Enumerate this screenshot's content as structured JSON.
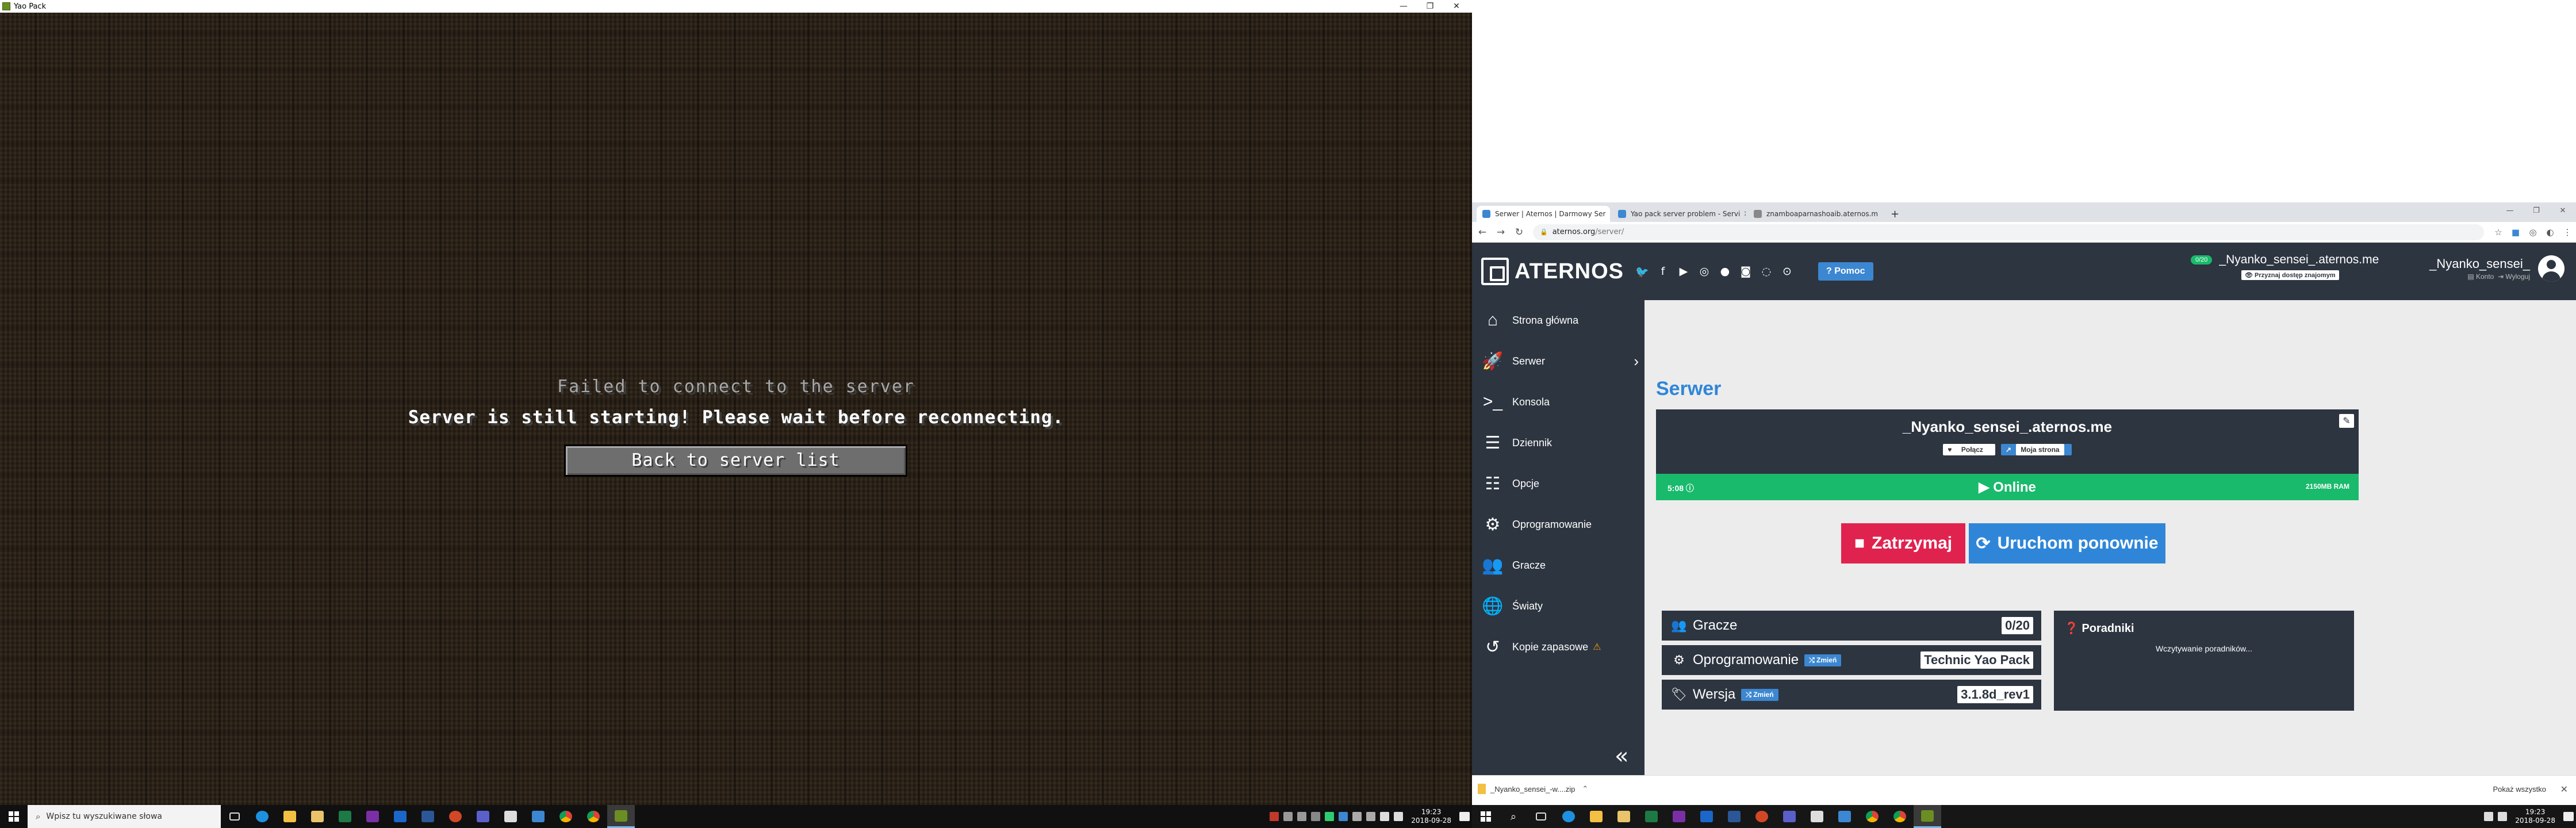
{
  "minecraft": {
    "window_title": "Yao Pack",
    "window_controls": {
      "minimize": "—",
      "maximize": "❐",
      "close": "✕"
    },
    "title": "Failed to connect to the server",
    "reason": "Server is still starting! Please wait before reconnecting.",
    "back_button": "Back to server list"
  },
  "taskbar_left": {
    "search_placeholder": "Wpisz tu wyszukiwane słowa",
    "clock_time": "19:23",
    "clock_date": "2018-09-28"
  },
  "taskbar_right": {
    "clock_time": "19:23",
    "clock_date": "2018-09-28"
  },
  "chrome": {
    "tabs": [
      {
        "label": "Serwer | Aternos | Darmowy Ser",
        "favicon_color": "#3c87d1"
      },
      {
        "label": "Yao pack server problem - Servi",
        "favicon_color": "#3c87d1"
      },
      {
        "label": "znamboaparnashoaib.aternos.m",
        "favicon_color": "#888888"
      }
    ],
    "new_tab": "+",
    "url_host": "aternos.org",
    "url_path": "/server/"
  },
  "aternos": {
    "logo": "ATERNOS",
    "help_button": "Pomoc",
    "status_pill": "0/20",
    "server_address": "_Nyanko_sensei_.aternos.me",
    "invite_button": "Przyznaj dostęp znajomym",
    "username": "_Nyanko_sensei_",
    "user_account": "Konto",
    "user_logout": "Wyloguj",
    "sidebar": [
      {
        "label": "Strona główna",
        "icon": "home-icon"
      },
      {
        "label": "Serwer",
        "icon": "rocket-icon"
      },
      {
        "label": "Konsola",
        "icon": "terminal-icon"
      },
      {
        "label": "Dziennik",
        "icon": "log-icon"
      },
      {
        "label": "Opcje",
        "icon": "sliders-icon"
      },
      {
        "label": "Oprogramowanie",
        "icon": "cogs-icon"
      },
      {
        "label": "Gracze",
        "icon": "users-icon"
      },
      {
        "label": "Światy",
        "icon": "globe-icon"
      },
      {
        "label": "Kopie zapasowe",
        "icon": "backup-icon"
      }
    ],
    "page_title": "Serwer",
    "card_address": "_Nyanko_sensei_.aternos.me",
    "connect_button": "Połącz",
    "my_page_button": "Moja strona",
    "status_left": "5:08",
    "status_center": "Online",
    "status_ram": "2150MB RAM",
    "stop_button": "Zatrzymaj",
    "restart_button": "Uruchom ponownie",
    "players_label": "Gracze",
    "players_value": "0/20",
    "software_label": "Oprogramowanie",
    "software_change": "Zmień",
    "software_value": "Technic Yao Pack",
    "version_label": "Wersja",
    "version_change": "Zmień",
    "version_value": "3.1.8d_rev1",
    "guides_title": "Poradniki",
    "guides_loading": "Wczytywanie poradników..."
  },
  "downloads": {
    "file": "_Nyanko_sensei_-w....zip",
    "show_all": "Pokaż wszystko"
  }
}
